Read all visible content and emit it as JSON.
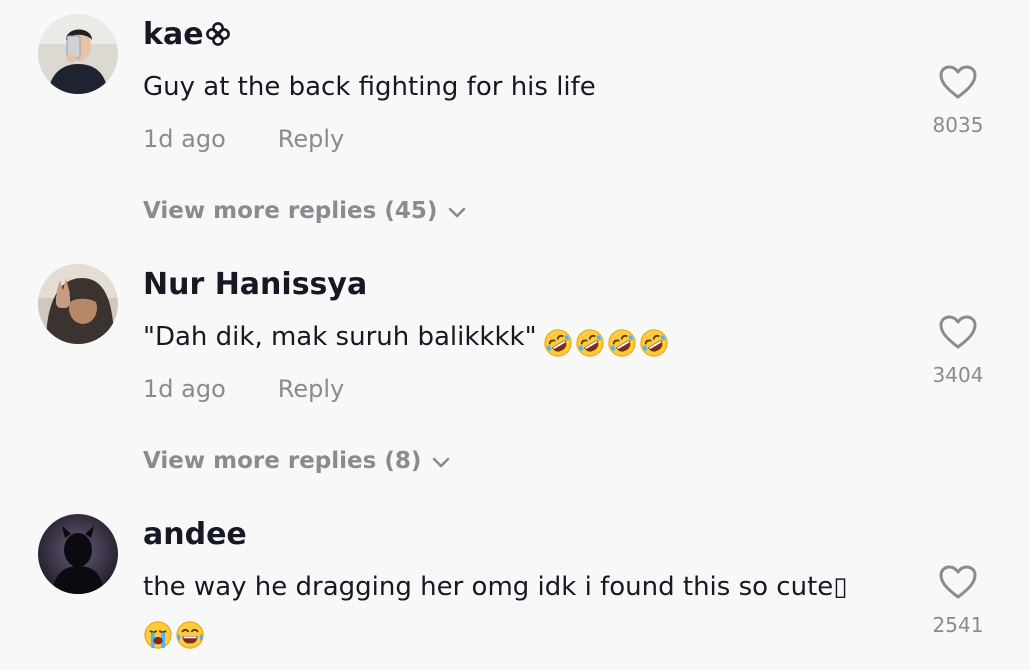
{
  "comments": [
    {
      "username": "kae",
      "text": "Guy at the back fighting for his life",
      "time": "1d ago",
      "reply_label": "Reply",
      "view_more": "View more replies (45)",
      "likes": "8035"
    },
    {
      "username": "Nur Hanissya",
      "text": "\"Dah dik, mak suruh balikkkk\"",
      "time": "1d ago",
      "reply_label": "Reply",
      "view_more": "View more replies (8)",
      "likes": "3404"
    },
    {
      "username": "andee",
      "text": "the way he dragging her omg idk i found this so cute▯",
      "likes": "2541"
    }
  ],
  "icons": {
    "like": "heart-outline-icon",
    "expand": "chevron-down-icon",
    "username_decoration": "four-leaf-clover-icon",
    "rofl": "rolling-on-floor-laughing-emoji",
    "sob": "loudly-crying-emoji",
    "joy": "tears-of-joy-emoji"
  },
  "colors": {
    "background": "#f8f8f8",
    "primary_text": "#161823",
    "secondary_text": "#8a8b91"
  }
}
